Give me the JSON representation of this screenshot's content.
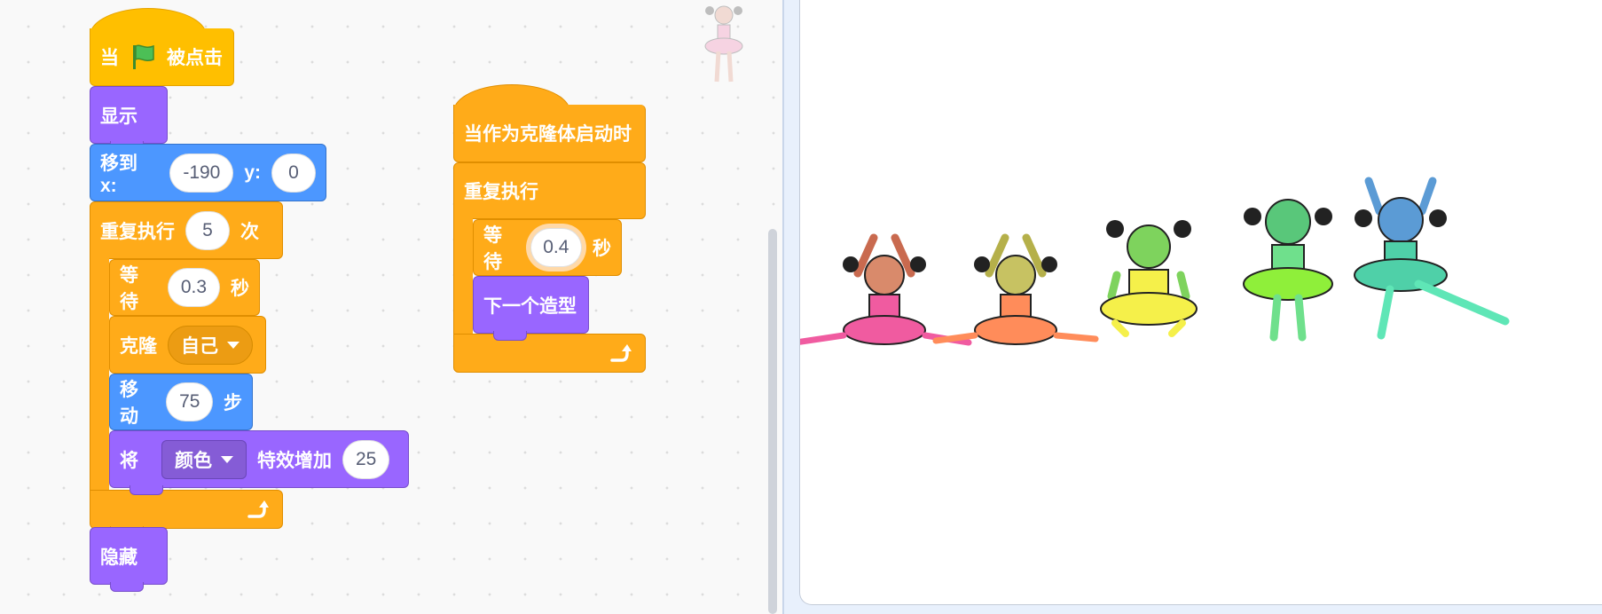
{
  "script_main": {
    "hat": {
      "when": "当",
      "clicked": "被点击"
    },
    "show": "显示",
    "goto": {
      "label": "移到 x:",
      "x": "-190",
      "y_label": "y:",
      "y": "0"
    },
    "repeat": {
      "label": "重复执行",
      "times": "5",
      "suffix": "次"
    },
    "wait": {
      "label": "等待",
      "value": "0.3",
      "unit": "秒"
    },
    "clone": {
      "label": "克隆",
      "target": "自己"
    },
    "move": {
      "label": "移动",
      "value": "75",
      "unit": "步"
    },
    "effect": {
      "label": "将",
      "effect": "颜色",
      "action": "特效增加",
      "value": "25"
    },
    "hide": "隐藏"
  },
  "script_clone": {
    "hat": "当作为克隆体启动时",
    "forever": "重复执行",
    "wait": {
      "label": "等待",
      "value": "0.4",
      "unit": "秒"
    },
    "next_costume": "下一个造型"
  },
  "colors": {
    "events": "#ffbf00",
    "control": "#ffab19",
    "looks": "#9966ff",
    "motion": "#4c97ff"
  },
  "stage": {
    "sprite": "ballerina",
    "clone_count": 5
  }
}
